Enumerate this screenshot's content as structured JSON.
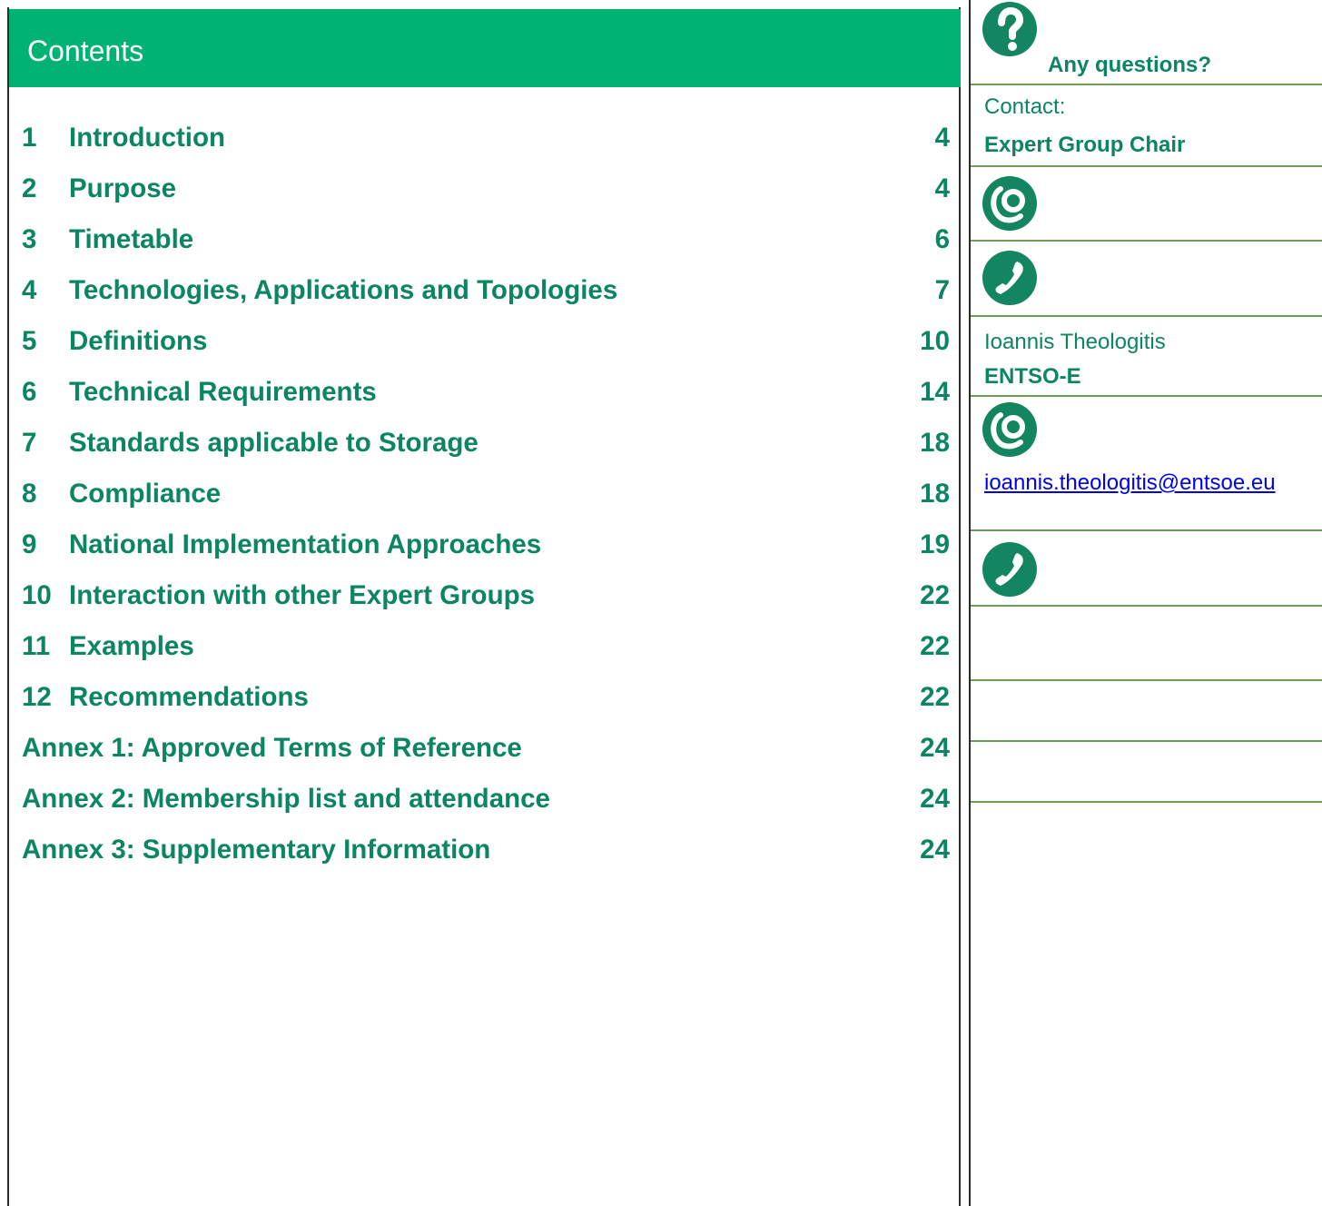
{
  "contents": {
    "title": "Contents",
    "entries": [
      {
        "num": "1",
        "title": "Introduction",
        "page": "4"
      },
      {
        "num": "2",
        "title": "Purpose",
        "page": "4"
      },
      {
        "num": "3",
        "title": "Timetable",
        "page": "6"
      },
      {
        "num": "4",
        "title": "Technologies, Applications and Topologies",
        "page": "7"
      },
      {
        "num": "5",
        "title": "Definitions",
        "page": "10"
      },
      {
        "num": "6",
        "title": "Technical Requirements",
        "page": "14"
      },
      {
        "num": "7",
        "title": "Standards applicable to Storage",
        "page": "18"
      },
      {
        "num": "8",
        "title": "Compliance",
        "page": "18"
      },
      {
        "num": "9",
        "title": "National Implementation Approaches",
        "page": "19"
      },
      {
        "num": "10",
        "title": "Interaction with other Expert Groups",
        "page": "22"
      },
      {
        "num": "11",
        "title": "Examples",
        "page": "22"
      },
      {
        "num": "12",
        "title": "Recommendations",
        "page": "22"
      },
      {
        "num": "",
        "title": "Annex 1: Approved Terms of Reference",
        "page": "24"
      },
      {
        "num": "",
        "title": "Annex 2: Membership list and attendance",
        "page": "24"
      },
      {
        "num": "",
        "title": "Annex 3: Supplementary Information",
        "page": "24"
      }
    ]
  },
  "sidebar": {
    "questions_label": "Any questions?",
    "contact_label": "Contact:",
    "chair_label": "Expert Group Chair",
    "person_name": "Ioannis Theologitis",
    "person_org": "ENTSO-E",
    "email": "ioannis.theologitis@entsoe.eu"
  },
  "icons": {
    "question": "question-mark-icon",
    "email": "email-at-icon",
    "phone": "phone-handset-icon"
  },
  "colors": {
    "header_green": "#00b373",
    "text_green": "#0c8562",
    "icon_green": "#138560",
    "divider_green": "#6d9d5a",
    "link_blue": "#0000ee"
  }
}
